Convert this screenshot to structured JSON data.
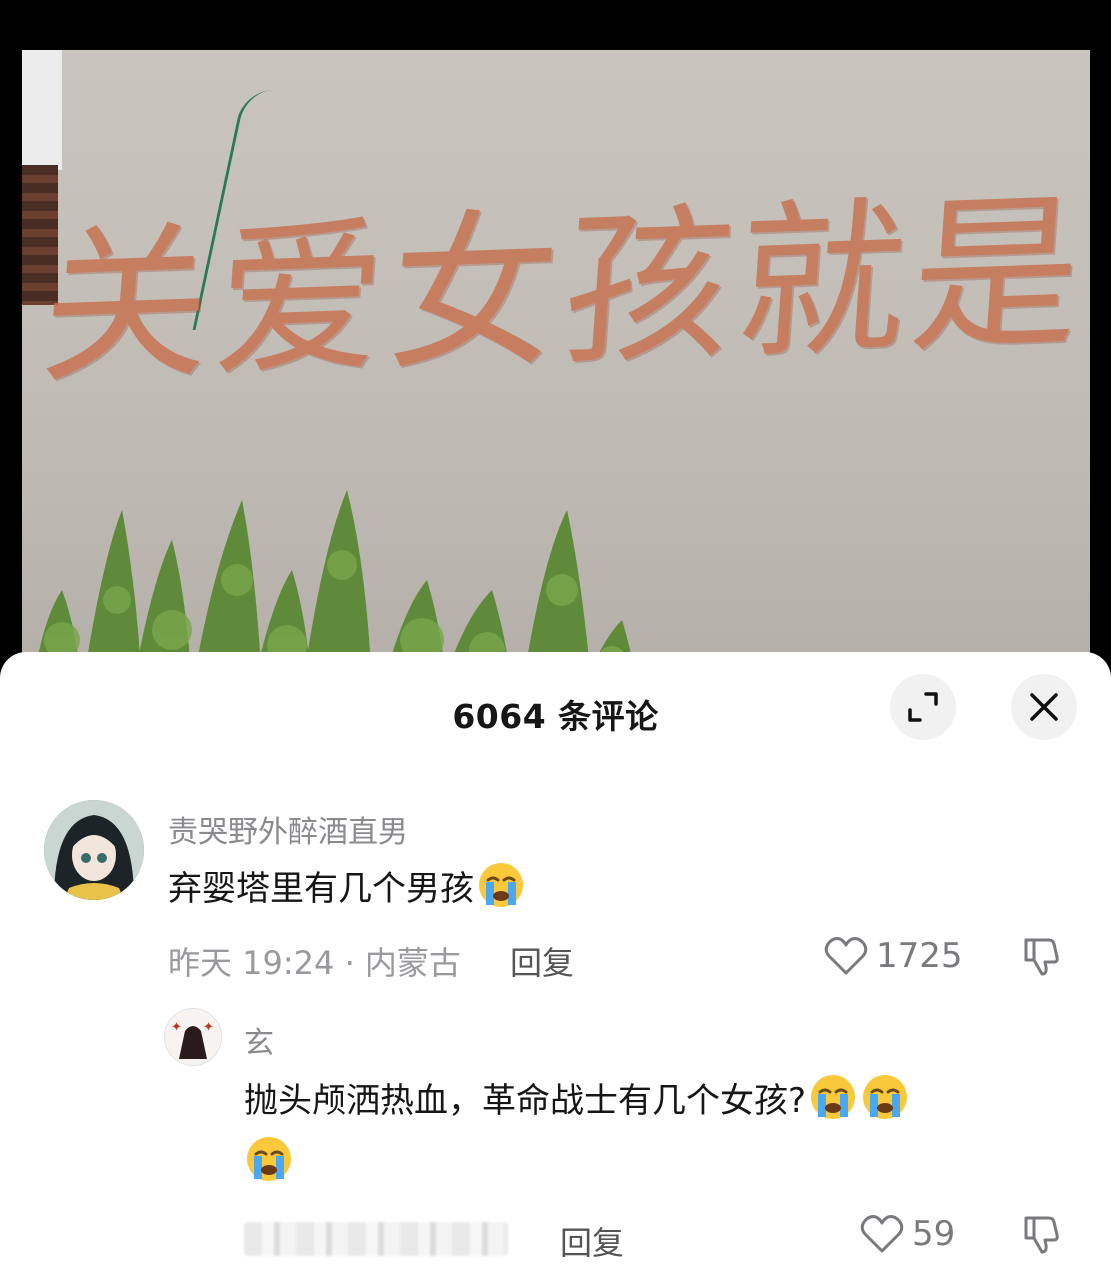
{
  "photo": {
    "wall_slogan": "关爱女孩就是关"
  },
  "comments_panel": {
    "title": "6064 条评论",
    "expand_icon": "expand-icon",
    "close_icon": "close-icon"
  },
  "comments": [
    {
      "username": "责哭野外醉酒直男",
      "text": "弃婴塔里有几个男孩",
      "emoji": "loudly-crying-face",
      "meta": "昨天 19:24 · 内蒙古",
      "reply_label": "回复",
      "likes": "1725"
    },
    {
      "username": "玄",
      "text": "抛头颅洒热血，革命战士有几个女孩?",
      "emoji_count": 3,
      "reply_label": "回复",
      "likes": "59"
    }
  ],
  "colors": {
    "sheet_bg": "#ffffff",
    "text_primary": "#161616",
    "text_secondary": "#8a8a8e",
    "slogan_red": "#c77352"
  }
}
